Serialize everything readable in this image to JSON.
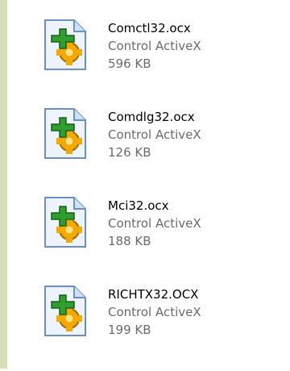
{
  "files": [
    {
      "name": "Comctl32.ocx",
      "type": "Control ActiveX",
      "size": "596 KB",
      "icon": "activex-control-file-icon"
    },
    {
      "name": "Comdlg32.ocx",
      "type": "Control ActiveX",
      "size": "126 KB",
      "icon": "activex-control-file-icon"
    },
    {
      "name": "Mci32.ocx",
      "type": "Control ActiveX",
      "size": "188 KB",
      "icon": "activex-control-file-icon"
    },
    {
      "name": "RICHTX32.OCX",
      "type": "Control ActiveX",
      "size": "199 KB",
      "icon": "activex-control-file-icon"
    }
  ],
  "colors": {
    "sidebar": "#d6dfb3",
    "secondary_text": "#6b6b6b"
  }
}
